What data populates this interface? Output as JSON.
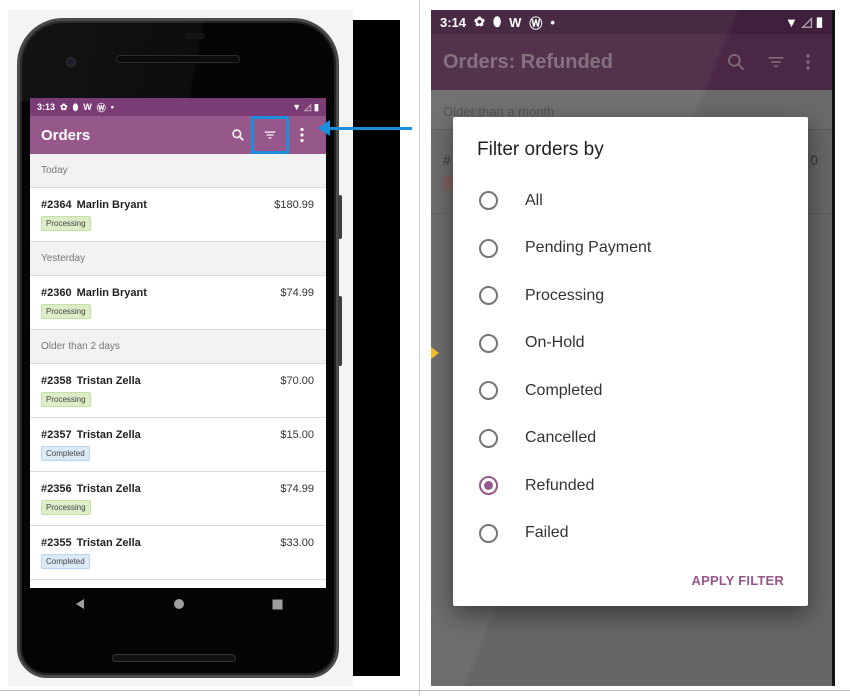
{
  "left_phone": {
    "status_bar": {
      "time": "3:13"
    },
    "app_bar": {
      "title": "Orders",
      "search_icon": "search-icon",
      "filter_icon": "filter-icon",
      "more_icon": "more-vert-icon"
    },
    "sections": [
      {
        "header": "Today",
        "orders": [
          {
            "number": "#2364",
            "customer": "Marlin Bryant",
            "total": "$180.99",
            "status": "Processing"
          }
        ]
      },
      {
        "header": "Yesterday",
        "orders": [
          {
            "number": "#2360",
            "customer": "Marlin Bryant",
            "total": "$74.99",
            "status": "Processing"
          }
        ]
      },
      {
        "header": "Older than 2 days",
        "orders": [
          {
            "number": "#2358",
            "customer": "Tristan Zella",
            "total": "$70.00",
            "status": "Processing"
          },
          {
            "number": "#2357",
            "customer": "Tristan Zella",
            "total": "$15.00",
            "status": "Completed"
          },
          {
            "number": "#2356",
            "customer": "Tristan Zella",
            "total": "$74.99",
            "status": "Processing"
          },
          {
            "number": "#2355",
            "customer": "Tristan Zella",
            "total": "$33.00",
            "status": "Completed"
          }
        ]
      }
    ]
  },
  "right_phone": {
    "status_bar": {
      "time": "3:14"
    },
    "app_bar": {
      "title": "Orders: Refunded"
    },
    "background_section": "Older than a month",
    "background_row_fragment": {
      "left": "#",
      "right": "0"
    },
    "dialog": {
      "title": "Filter orders by",
      "options": [
        {
          "label": "All",
          "checked": false
        },
        {
          "label": "Pending Payment",
          "checked": false
        },
        {
          "label": "Processing",
          "checked": false
        },
        {
          "label": "On-Hold",
          "checked": false
        },
        {
          "label": "Completed",
          "checked": false
        },
        {
          "label": "Cancelled",
          "checked": false
        },
        {
          "label": "Refunded",
          "checked": true
        },
        {
          "label": "Failed",
          "checked": false
        }
      ],
      "apply_label": "APPLY FILTER"
    }
  },
  "colors": {
    "brand_purple": "#96588a",
    "annotation_blue": "#1a8fde",
    "processing_badge": "#dcedc8",
    "completed_badge": "#dbeaf7"
  }
}
